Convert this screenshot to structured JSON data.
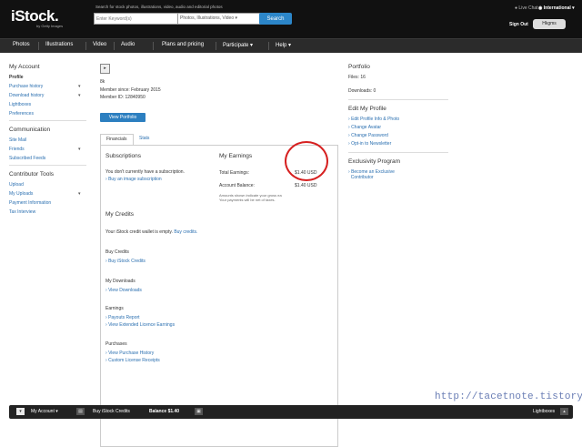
{
  "header": {
    "logo": "iStock.",
    "logo_sub": "by Getty Images",
    "search_hint": "Search for stock photos, illustrations, video, audio and editorial photos",
    "search_placeholder": "Enter Keyword(s)",
    "search_type": "Photos, Illustrations, Video",
    "search_button": "Search",
    "live_chat": "Live Chat",
    "language": "International",
    "sign_out": "Sign Out",
    "username": "Hkgms"
  },
  "nav": {
    "items": [
      "Photos",
      "Illustrations",
      "Video",
      "Audio",
      "Plans and pricing",
      "Participate",
      "Help"
    ]
  },
  "sidebar": {
    "my_account_heading": "My Account",
    "my_account_items": [
      "Profile",
      "Purchase history",
      "Download history",
      "Lightboxes",
      "Preferences"
    ],
    "communication_heading": "Communication",
    "communication_items": [
      "Site Mail",
      "Friends",
      "Subscribed Feeds"
    ],
    "contributor_heading": "Contributor Tools",
    "contributor_items": [
      "Upload",
      "My Uploads",
      "Payment Information",
      "Tax Interview"
    ]
  },
  "profile": {
    "thumb": "▸",
    "username": "8k",
    "member_since": "Member since: February 2015",
    "member_id": "Member ID: 12840950",
    "view_portfolio": "View Portfolio"
  },
  "tabs": [
    "Financials",
    "Stats"
  ],
  "financials": {
    "subscriptions_heading": "Subscriptions",
    "subscriptions_text": "You don't currently have a subscription.",
    "buy_subscription": "Buy an image subscription",
    "earnings_heading": "My Earnings",
    "total_earnings_label": "Total Earnings:",
    "total_earnings_value": "$1.40 USD",
    "account_balance_label": "Account Balance:",
    "account_balance_value": "$1.40 USD",
    "earnings_note_1": "Amounts shown indicate your gross ea",
    "earnings_note_2": "Your payments will be net of taxes.",
    "credits_heading": "My Credits",
    "credits_text": "Your iStock credit wallet is empty.",
    "buy_credits_inline": "Buy credits.",
    "buy_credits_heading": "Buy Credits",
    "buy_credits_link": "Buy iStock Credits",
    "downloads_heading": "My Downloads",
    "view_downloads": "View Downloads",
    "earnings_section_heading": "Earnings",
    "payouts_report": "Payouts Report",
    "extended_licence": "View Extended Licence Earnings",
    "purchases_heading": "Purchases",
    "purchase_history": "View Purchase History",
    "custom_receipts": "Custom License Receipts"
  },
  "right": {
    "portfolio_heading": "Portfolio",
    "files": "Files: 16",
    "downloads": "Downloads: 0",
    "edit_heading": "Edit My Profile",
    "edit_links": [
      "Edit Profile Info & Photo",
      "Change Avatar",
      "Change Password",
      "Opt-in to Newsletter"
    ],
    "exclusivity_heading": "Exclusivity Program",
    "exclusive_link_1": "Become an Exclusive",
    "exclusive_link_2": "Contributor"
  },
  "bottombar": {
    "my_account": "My Account",
    "buy_credits": "Buy iStock Credits",
    "balance": "Balance $1.40",
    "lightboxes": "Lightboxes"
  },
  "watermark": "http://tacetnote.tistory.com"
}
